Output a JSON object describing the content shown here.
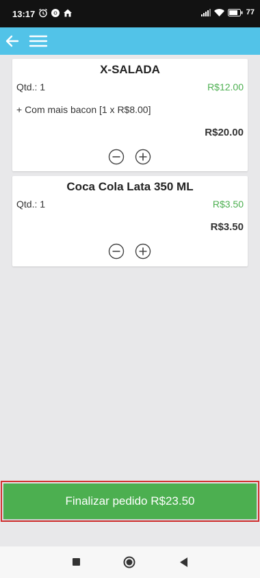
{
  "status_bar": {
    "time": "13:17",
    "battery": "77"
  },
  "cart": {
    "items": [
      {
        "name": "X-SALADA",
        "qty_label": "Qtd.: 1",
        "unit_price": "R$12.00",
        "extra": "+ Com mais bacon [1 x R$8.00]",
        "total": "R$20.00"
      },
      {
        "name": "Coca Cola Lata 350 ML",
        "qty_label": "Qtd.: 1",
        "unit_price": "R$3.50",
        "total": "R$3.50"
      }
    ]
  },
  "footer": {
    "finalize_label": "Finalizar pedido R$23.50"
  },
  "colors": {
    "app_bar": "#52c3e8",
    "price_green": "#4caf50",
    "button_green": "#4caf50",
    "highlight": "#d32f2f"
  }
}
